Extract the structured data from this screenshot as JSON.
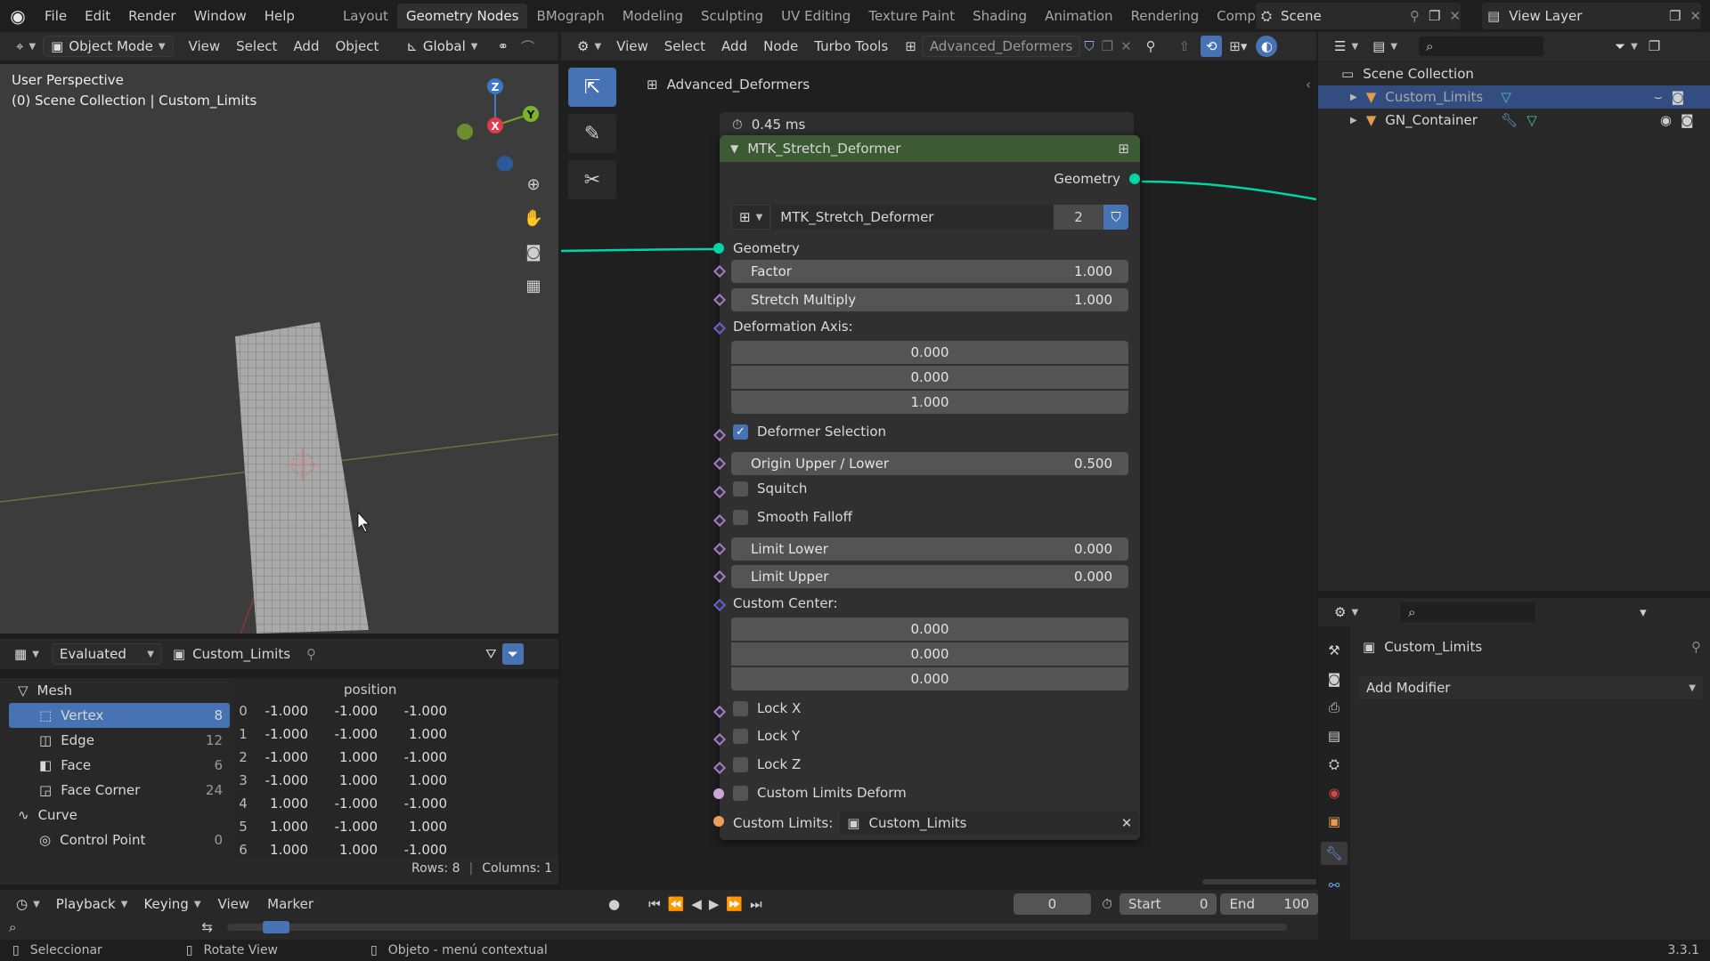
{
  "topbar": {
    "menus": [
      "File",
      "Edit",
      "Render",
      "Window",
      "Help"
    ],
    "workspaces": [
      "Layout",
      "Geometry Nodes",
      "BMograph",
      "Modeling",
      "Sculpting",
      "UV Editing",
      "Texture Paint",
      "Shading",
      "Animation",
      "Rendering",
      "Compositing"
    ],
    "active_workspace": "Geometry Nodes",
    "scene": "Scene",
    "view_layer": "View Layer"
  },
  "viewport": {
    "mode": "Object Mode",
    "menus": [
      "View",
      "Select",
      "Add",
      "Object"
    ],
    "orientation": "Global",
    "overlay_title": "User Perspective",
    "overlay_sub": "(0) Scene Collection | Custom_Limits",
    "gizmo": {
      "z": "Z",
      "y": "Y",
      "x": "X"
    }
  },
  "node_editor": {
    "menus": [
      "View",
      "Select",
      "Add",
      "Node",
      "Turbo Tools"
    ],
    "node_group": "Advanced_Deformers",
    "breadcrumb": "Advanced_Deformers",
    "timing": "0.45 ms",
    "node": {
      "title": "MTK_Stretch_Deformer",
      "output": "Geometry",
      "group_name": "MTK_Stretch_Deformer",
      "users": "2",
      "input_geometry": "Geometry",
      "factor": {
        "label": "Factor",
        "value": "1.000"
      },
      "stretch": {
        "label": "Stretch Multiply",
        "value": "1.000"
      },
      "axis_label": "Deformation Axis:",
      "axis": [
        "0.000",
        "0.000",
        "1.000"
      ],
      "deformer_selection": "Deformer Selection",
      "origin": {
        "label": "Origin Upper / Lower",
        "value": "0.500"
      },
      "squitch": "Squitch",
      "smooth": "Smooth Falloff",
      "limit_lower": {
        "label": "Limit Lower",
        "value": "0.000"
      },
      "limit_upper": {
        "label": "Limit Upper",
        "value": "0.000"
      },
      "center_label": "Custom Center:",
      "center": [
        "0.000",
        "0.000",
        "0.000"
      ],
      "lock_x": "Lock X",
      "lock_y": "Lock Y",
      "lock_z": "Lock Z",
      "custom_limits_deform": "Custom Limits Deform",
      "custom_limits_label": "Custom Limits:",
      "custom_limits_object": "Custom_Limits"
    }
  },
  "spreadsheet": {
    "mode": "Evaluated",
    "object": "Custom_Limits",
    "column": "position",
    "tree": [
      {
        "label": "Mesh",
        "count": ""
      },
      {
        "label": "Vertex",
        "count": "8"
      },
      {
        "label": "Edge",
        "count": "12"
      },
      {
        "label": "Face",
        "count": "6"
      },
      {
        "label": "Face Corner",
        "count": "24"
      },
      {
        "label": "Curve",
        "count": ""
      },
      {
        "label": "Control Point",
        "count": "0"
      }
    ],
    "rows": [
      [
        "0",
        "-1.000",
        "-1.000",
        "-1.000"
      ],
      [
        "1",
        "-1.000",
        "-1.000",
        "1.000"
      ],
      [
        "2",
        "-1.000",
        "1.000",
        "-1.000"
      ],
      [
        "3",
        "-1.000",
        "1.000",
        "1.000"
      ],
      [
        "4",
        "1.000",
        "-1.000",
        "-1.000"
      ],
      [
        "5",
        "1.000",
        "-1.000",
        "1.000"
      ],
      [
        "6",
        "1.000",
        "1.000",
        "-1.000"
      ]
    ],
    "footer_rows": "Rows: 8",
    "footer_cols": "Columns: 1"
  },
  "outliner": {
    "root": "Scene Collection",
    "items": [
      "Custom_Limits",
      "GN_Container"
    ]
  },
  "properties": {
    "object": "Custom_Limits",
    "add_modifier": "Add Modifier"
  },
  "timeline": {
    "menus": [
      "Playback",
      "Keying",
      "View",
      "Marker"
    ],
    "current": "0",
    "start_label": "Start",
    "start": "0",
    "end_label": "End",
    "end": "100"
  },
  "status": {
    "left": "Seleccionar",
    "mid": "Rotate View",
    "right": "Objeto - menú contextual",
    "version": "3.3.1"
  },
  "colors": {
    "geometry_socket": "#00d6a3",
    "node_header": "#3c5a33",
    "selected": "#4772b3",
    "object_socket": "#ed9e5c"
  }
}
